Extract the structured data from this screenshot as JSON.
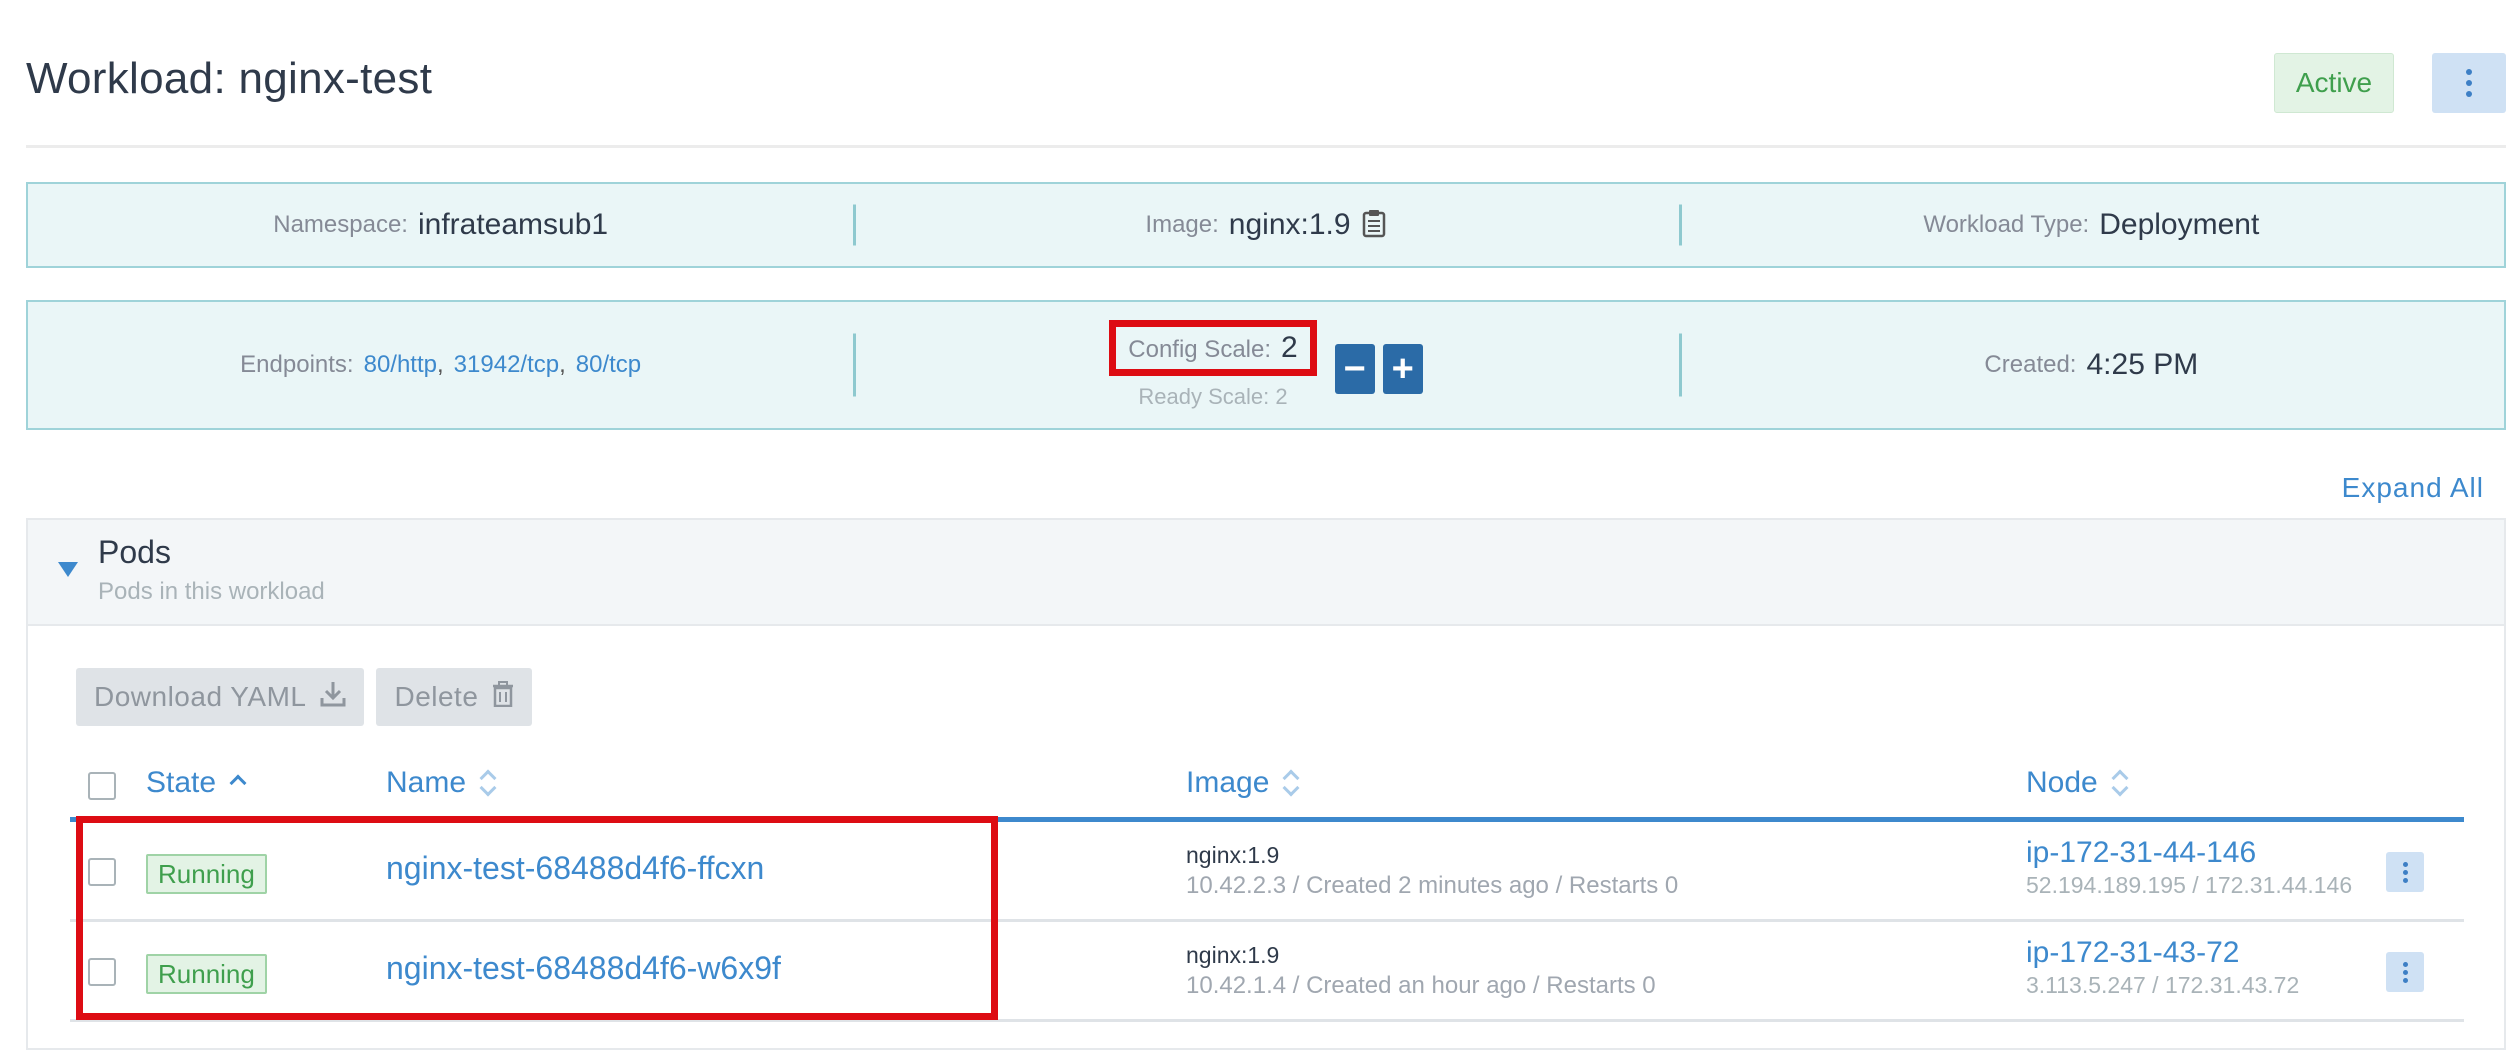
{
  "header": {
    "title": "Workload: nginx-test",
    "status": "Active",
    "menu_icon": "vertical-dots-icon"
  },
  "info": {
    "namespace_label": "Namespace:",
    "namespace_value": "infrateamsub1",
    "image_label": "Image:",
    "image_value": "nginx:1.9",
    "image_copy_icon": "clipboard-icon",
    "type_label": "Workload Type:",
    "type_value": "Deployment",
    "endpoints_label": "Endpoints:",
    "endpoints": [
      "80/http",
      "31942/tcp",
      "80/tcp"
    ],
    "config_scale_label": "Config Scale:",
    "config_scale_value": "2",
    "ready_scale": "Ready Scale: 2",
    "scale_down_label": "−",
    "scale_up_label": "+",
    "created_label": "Created:",
    "created_value": "4:25 PM"
  },
  "expand_all": "Expand All",
  "pods": {
    "title": "Pods",
    "subtitle": "Pods in this workload",
    "download_label": "Download YAML",
    "delete_label": "Delete",
    "columns": {
      "state": "State",
      "name": "Name",
      "image": "Image",
      "node": "Node"
    },
    "rows": [
      {
        "state": "Running",
        "name": "nginx-test-68488d4f6-ffcxn",
        "image": "nginx:1.9",
        "meta": "10.42.2.3 / Created 2 minutes ago / Restarts 0",
        "node": "ip-172-31-44-146",
        "ips": "52.194.189.195  /  172.31.44.146"
      },
      {
        "state": "Running",
        "name": "nginx-test-68488d4f6-w6x9f",
        "image": "nginx:1.9",
        "meta": "10.42.1.4 / Created an hour ago / Restarts 0",
        "node": "ip-172-31-43-72",
        "ips": "3.113.5.247  /  172.31.43.72"
      }
    ]
  },
  "colors": {
    "accent": "#3d89cd",
    "panel_bg": "#eaf6f7",
    "active_green": "#3f9f4d",
    "highlight_red": "#dd0c13"
  }
}
